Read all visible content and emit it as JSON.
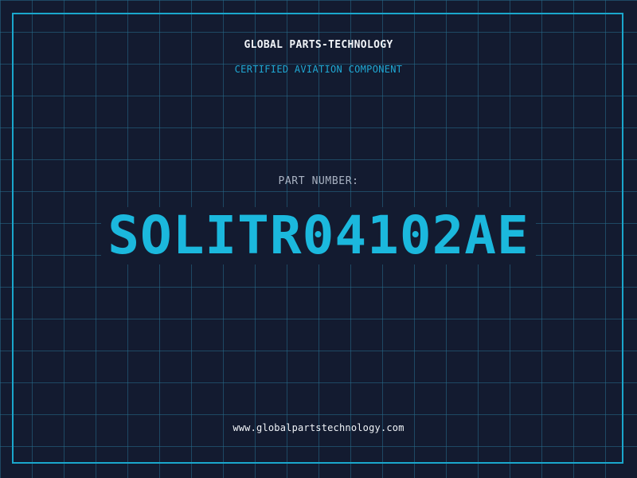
{
  "header": {
    "company": "GLOBAL PARTS-TECHNOLOGY",
    "subtitle": "CERTIFIED AVIATION COMPONENT"
  },
  "part": {
    "label": "PART NUMBER:",
    "number": "SOLITR04102AE"
  },
  "footer": {
    "website": "www.globalpartstechnology.com"
  },
  "colors": {
    "background": "#131b30",
    "grid": "#266e8c",
    "accent": "#1bb8dd",
    "text": "#f1f4f8",
    "muted": "#a9b2c2"
  }
}
